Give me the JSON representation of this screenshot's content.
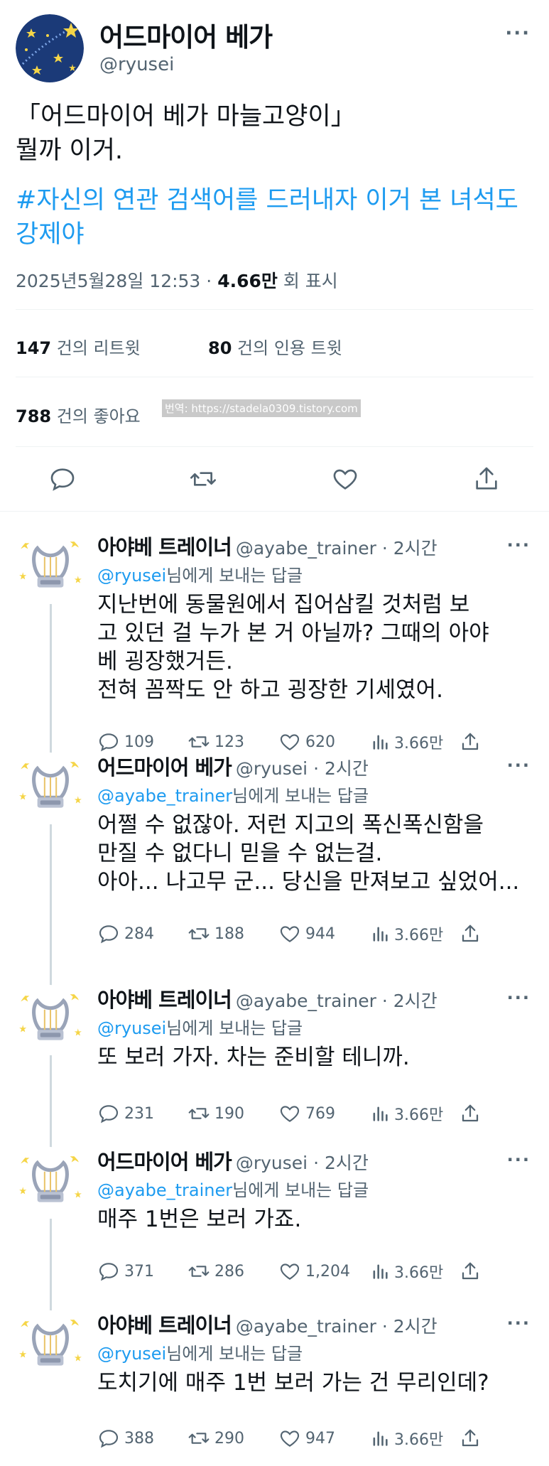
{
  "main": {
    "display_name": "어드마이어 베가",
    "handle": "@ryusei",
    "more": "···",
    "text": "「어드마이어 베가 마늘고양이」\n뭘까 이거.",
    "hashtag": "#자신의 연관 검색어를 드러내자 이거 본 녀석도 강제야",
    "timestamp": "2025년5월28일 12:53 · ",
    "views": "4.66만",
    "views_suffix": " 회 표시",
    "retweets_count": "147",
    "retweets_label": " 건의 리트윗",
    "quotes_count": "80",
    "quotes_label": " 건의 인용 트윗",
    "likes_count": "788",
    "likes_label": " 건의 좋아요",
    "watermark": "번역: https://stadela0309.tistory.com"
  },
  "replies": [
    {
      "name": "아야베 트레이너",
      "handle": "@ayabe_trainer · 2시간",
      "more": "···",
      "to_mention": "@ryusei",
      "to_suffix": "님에게 보내는 답글",
      "text": "지난번에 동물원에서 집어삼킬 것처럼 보\n고 있던 걸 누가 본 거 아닐까? 그때의 아야\n베 굉장했거든.\n전혀 꼼짝도 안 하고 굉장한 기세였어.",
      "replies": "109",
      "retweets": "123",
      "likes": "620",
      "views": "3.66만"
    },
    {
      "name": "어드마이어 베가",
      "handle": "@ryusei · 2시간",
      "more": "···",
      "to_mention": "@ayabe_trainer",
      "to_suffix": "님에게 보내는 답글",
      "text": "어쩔 수 없잖아. 저런 지고의 폭신폭신함을\n만질 수 없다니 믿을 수 없는걸.\n아아... 나고무 군... 당신을 만져보고 싶었어...",
      "replies": "284",
      "retweets": "188",
      "likes": "944",
      "views": "3.66만"
    },
    {
      "name": "아야베 트레이너",
      "handle": "@ayabe_trainer · 2시간",
      "more": "···",
      "to_mention": "@ryusei",
      "to_suffix": "님에게 보내는 답글",
      "text": "또 보러 가자. 차는 준비할 테니까.",
      "replies": "231",
      "retweets": "190",
      "likes": "769",
      "views": "3.66만"
    },
    {
      "name": "어드마이어 베가",
      "handle": "@ryusei · 2시간",
      "more": "···",
      "to_mention": "@ayabe_trainer",
      "to_suffix": "님에게 보내는 답글",
      "text": "매주 1번은 보러 가죠.",
      "replies": "371",
      "retweets": "286",
      "likes": "1,204",
      "views": "3.66만"
    },
    {
      "name": "아야베 트레이너",
      "handle": "@ayabe_trainer · 2시간",
      "more": "···",
      "to_mention": "@ryusei",
      "to_suffix": "님에게 보내는 답글",
      "text": "도치기에 매주 1번 보러 가는 건 무리인데?",
      "replies": "388",
      "retweets": "290",
      "likes": "947",
      "views": "3.66만"
    }
  ],
  "colors": {
    "accent": "#1d9bf0",
    "text": "#0f1419",
    "secondary": "#536471",
    "avatar_navy": "#1b3a78",
    "star_yellow": "#f5d547"
  },
  "icons": [
    "reply-icon",
    "retweet-icon",
    "like-icon",
    "share-icon",
    "views-icon",
    "star-avatar-icon",
    "harp-avatar-icon",
    "more-icon"
  ]
}
